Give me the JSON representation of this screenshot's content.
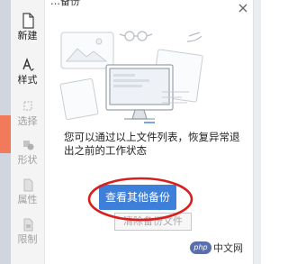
{
  "dialog": {
    "title": "…备份"
  },
  "sidebar": {
    "items": [
      {
        "label": "新建",
        "icon": "document-icon",
        "enabled": true
      },
      {
        "label": "样式",
        "icon": "text-style-icon",
        "enabled": true
      },
      {
        "label": "选择",
        "icon": "select-icon",
        "enabled": false
      },
      {
        "label": "形状",
        "icon": "shape-icon",
        "enabled": false
      },
      {
        "label": "属性",
        "icon": "properties-icon",
        "enabled": false
      },
      {
        "label": "限制",
        "icon": "lock-icon",
        "enabled": false
      }
    ]
  },
  "main": {
    "message": "您可以通过以上文件列表，恢复异常退出之前的工作状态",
    "primary_button": "查看其他备份",
    "secondary_button": "清除备份文件"
  },
  "watermark": {
    "logo": "php",
    "text": "中文网"
  },
  "colors": {
    "primary": "#3d7fd9",
    "annotation": "#d81e1e",
    "sidebar_bg": "#f4f4f4"
  }
}
